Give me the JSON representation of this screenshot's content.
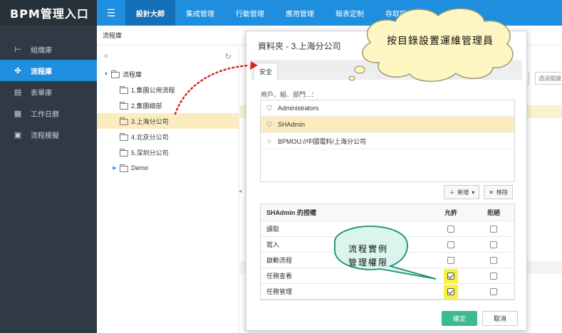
{
  "sidebar": {
    "brand": "BPM管理入口",
    "items": [
      {
        "label": "組織庫",
        "icon": "org-icon"
      },
      {
        "label": "流程庫",
        "icon": "flow-icon",
        "active": true
      },
      {
        "label": "表單庫",
        "icon": "form-icon"
      },
      {
        "label": "工作日曆",
        "icon": "calendar-icon"
      },
      {
        "label": "流程模擬",
        "icon": "simulate-icon"
      }
    ]
  },
  "topbar": {
    "tabs": [
      {
        "label": "設計大師",
        "active": true
      },
      {
        "label": "集成管理"
      },
      {
        "label": "行動管理"
      },
      {
        "label": "應用管理"
      },
      {
        "label": "報表定制"
      },
      {
        "label": "存取控制"
      }
    ]
  },
  "breadcrumb": "流程庫",
  "tree": {
    "root": "流程庫",
    "children": [
      {
        "label": "1.集團公用流程"
      },
      {
        "label": "2.集團總部"
      },
      {
        "label": "3.上海分公司",
        "selected": true
      },
      {
        "label": "4.北京分公司"
      },
      {
        "label": "5.深圳分公司"
      },
      {
        "label": "Demo",
        "collapsed": true
      }
    ]
  },
  "background": {
    "search_placeholder": "遇週關鍵"
  },
  "dialog": {
    "title": "資料夾 - 3.上海分公司",
    "tab": "安全",
    "users_label": "用戶、組、部門...：",
    "users": [
      {
        "label": "Administrators",
        "icon": "shield-icon"
      },
      {
        "label": "SHAdmin",
        "icon": "shield-icon",
        "selected": true
      },
      {
        "label": "BPMOU://中國電料/上海分公司",
        "icon": "home-icon"
      }
    ],
    "add_label": "新增",
    "remove_label": "移除",
    "perm_header": {
      "name": "SHAdmin 的授權",
      "allow": "允許",
      "deny": "拒絕"
    },
    "perms": [
      {
        "name": "讀取",
        "allow": false,
        "deny": false
      },
      {
        "name": "寫入",
        "allow": false,
        "deny": false
      },
      {
        "name": "啟動流程",
        "allow": false,
        "deny": false
      },
      {
        "name": "任務查看",
        "allow": true,
        "deny": false
      },
      {
        "name": "任務管理",
        "allow": true,
        "deny": false
      }
    ],
    "ok_label": "確定",
    "cancel_label": "取消"
  },
  "callouts": {
    "cloud": "按目錄設置運維管理員",
    "bubble_line1": "流程實例",
    "bubble_line2": "管理權限"
  },
  "colors": {
    "accent": "#1f8ede",
    "sidebar": "#2f3a44",
    "selection": "#fbecc0",
    "ok": "#3dba8c",
    "highlight": "#f6f33f"
  }
}
